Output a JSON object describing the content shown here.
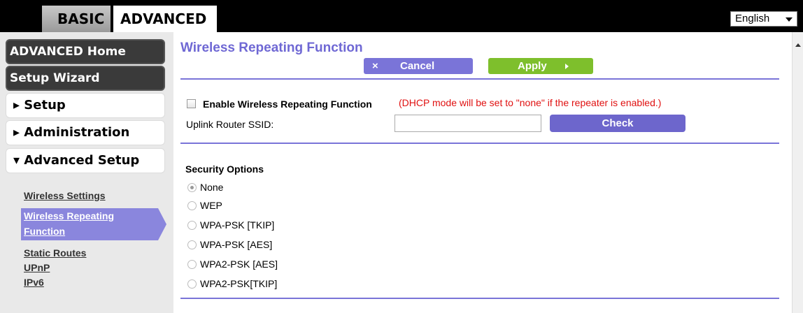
{
  "tabs": {
    "basic": "BASIC",
    "advanced": "ADVANCED"
  },
  "language": {
    "selected": "English"
  },
  "sidebar": {
    "advanced_home": "ADVANCED Home",
    "setup_wizard": "Setup Wizard",
    "setup": "▸ Setup",
    "administration": "▸ Administration",
    "advanced_setup": "▾ Advanced Setup",
    "links": {
      "wireless_settings": "Wireless Settings",
      "wireless_repeating_1": "Wireless Repeating",
      "wireless_repeating_2": "Function",
      "static_routes": "Static Routes",
      "upnp": "UPnP",
      "ipv6": "IPv6"
    }
  },
  "main": {
    "title": "Wireless Repeating Function",
    "cancel_icon": "×",
    "cancel_label": "Cancel",
    "apply_label": "Apply",
    "enable_label": "Enable Wireless Repeating Function",
    "dhcp_note": "(DHCP mode will be set to \"none\" if the repeater is enabled.)",
    "ssid_label": "Uplink Router SSID:",
    "ssid_value": "",
    "check_label": "Check",
    "security_title": "Security Options",
    "security_options": [
      "None",
      "WEP",
      "WPA-PSK [TKIP]",
      "WPA-PSK [AES]",
      "WPA2-PSK [AES]",
      "WPA2-PSK[TKIP]"
    ],
    "security_selected": "None"
  },
  "colors": {
    "accent": "#7a74d8",
    "apply": "#7ebf2c",
    "warning": "#e01010"
  }
}
